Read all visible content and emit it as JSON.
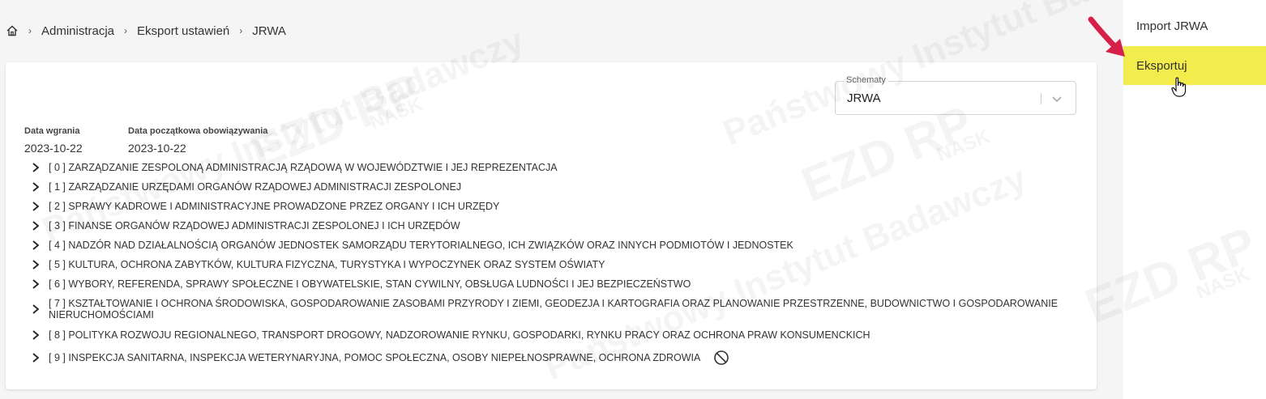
{
  "breadcrumb": {
    "items": [
      "Administracja",
      "Eksport ustawień",
      "JRWA"
    ]
  },
  "schema": {
    "label": "Schematy",
    "value": "JRWA"
  },
  "dates": {
    "upload_label": "Data wgrania",
    "upload_value": "2023-10-22",
    "start_label": "Data początkowa obowiązywania",
    "start_value": "2023-10-22"
  },
  "tree": [
    "[ 0 ] ZARZĄDZANIE ZESPOLONĄ ADMINISTRACJĄ RZĄDOWĄ W WOJEWÓDZTWIE I JEJ REPREZENTACJA",
    "[ 1 ] ZARZĄDZANIE URZĘDAMI ORGANÓW RZĄDOWEJ ADMINISTRACJI ZESPOLONEJ",
    "[ 2 ] SPRAWY KADROWE I ADMINISTRACYJNE PROWADZONE PRZEZ ORGANY I ICH URZĘDY",
    "[ 3 ] FINANSE ORGANÓW RZĄDOWEJ ADMINISTRACJI ZESPOLONEJ I ICH URZĘDÓW",
    "[ 4 ] NADZÓR NAD DZIAŁALNOŚCIĄ ORGANÓW JEDNOSTEK SAMORZĄDU TERYTORIALNEGO, ICH ZWIĄZKÓW ORAZ INNYCH PODMIOTÓW I JEDNOSTEK",
    "[ 5 ] KULTURA, OCHRONA ZABYTKÓW, KULTURA FIZYCZNA, TURYSTYKA I WYPOCZYNEK ORAZ SYSTEM OŚWIATY",
    "[ 6 ] WYBORY, REFERENDA, SPRAWY SPOŁECZNE I OBYWATELSKIE, STAN CYWILNY, OBSŁUGA LUDNOŚCI I JEJ BEZPIECZEŃSTWO",
    "[ 7 ] KSZTAŁTOWANIE I OCHRONA ŚRODOWISKA, GOSPODAROWANIE ZASOBAMI PRZYRODY I ZIEMI, GEODEZJA I KARTOGRAFIA ORAZ PLANOWANIE PRZESTRZENNE, BUDOWNICTWO I GOSPODAROWANIE NIERUCHOMOŚCIAMI",
    "[ 8 ] POLITYKA ROZWOJU REGIONALNEGO, TRANSPORT DROGOWY, NADZOROWANIE RYNKU, GOSPODARKI, RYNKU PRACY ORAZ OCHRONA PRAW KONSUMENCKICH",
    "[ 9 ] INSPEKCJA SANITARNA, INSPEKCJA WETERYNARYJNA, POMOC SPOŁECZNA, OSOBY NIEPEŁNOSPRAWNE, OCHRONA ZDROWIA"
  ],
  "side_menu": {
    "import_label": "Import JRWA",
    "export_label": "Eksportuj"
  },
  "watermark": {
    "text": "Państwowy Instytut Badawczy",
    "logo": "EZD RP",
    "sub": "NASK"
  },
  "colors": {
    "highlight": "#f2ec4d",
    "arrow": "#d6204a"
  },
  "icons": {
    "home": "home-icon",
    "expand": "chevron-right-icon",
    "ban": "ban-icon",
    "cursor": "hand-pointer-icon"
  }
}
